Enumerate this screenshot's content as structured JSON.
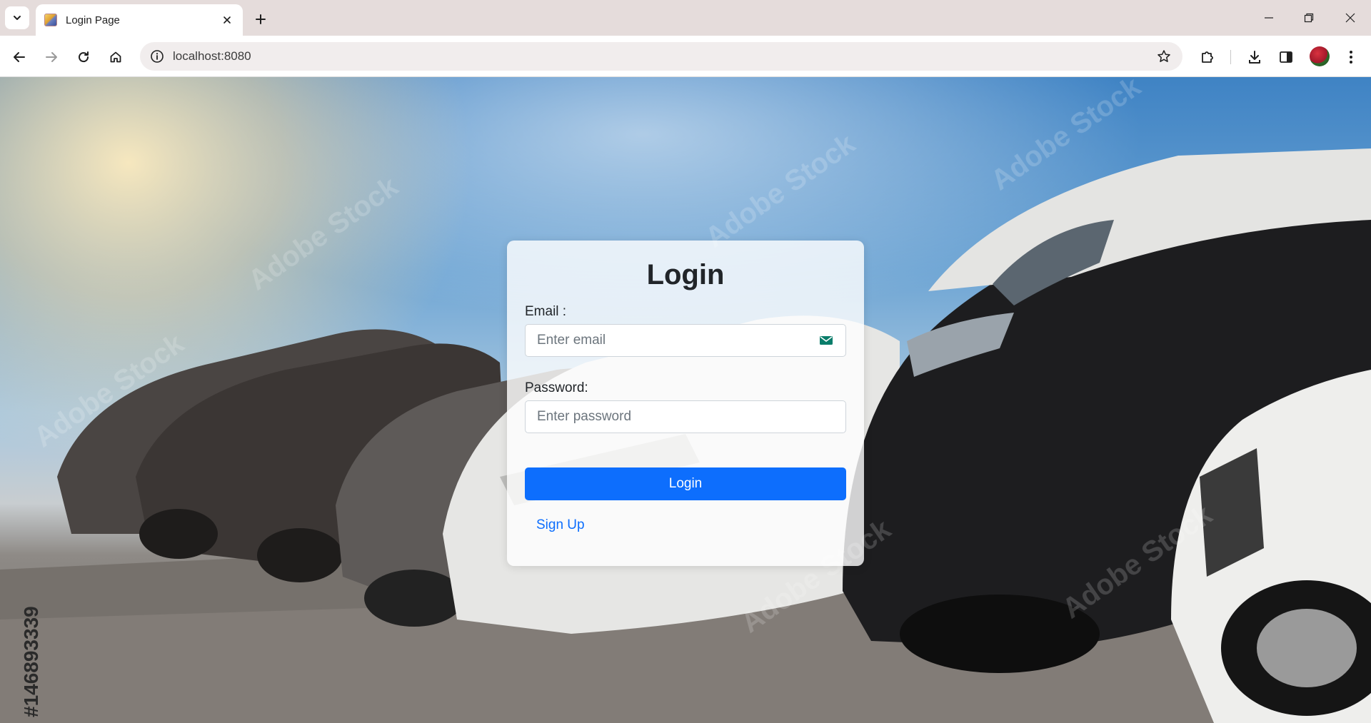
{
  "browser": {
    "tab_title": "Login Page",
    "url": "localhost:8080",
    "icons": {
      "tab_search": "chevron-down-icon",
      "tab_close": "close-icon",
      "new_tab": "plus-icon",
      "minimize": "minimize-icon",
      "restore": "restore-icon",
      "close_window": "close-icon",
      "back": "arrow-left-icon",
      "forward": "arrow-right-icon",
      "reload": "reload-icon",
      "home": "home-icon",
      "site_info": "info-icon",
      "bookmark": "star-icon",
      "extensions": "puzzle-icon",
      "downloads": "download-icon",
      "side_panel": "side-panel-icon",
      "profile": "avatar",
      "menu": "kebab-menu-icon"
    }
  },
  "background": {
    "description_colors": {
      "sky": "#3f83c4",
      "sun": "#ffe9b8",
      "ground": "#6e6b68"
    },
    "stock_id": "#146893339"
  },
  "login": {
    "title": "Login",
    "email_label": "Email :",
    "email_placeholder": "Enter email",
    "password_label": "Password:",
    "password_placeholder": "Enter password",
    "submit_label": "Login",
    "signup_link": "Sign Up",
    "accent_color": "#0d6efd"
  }
}
